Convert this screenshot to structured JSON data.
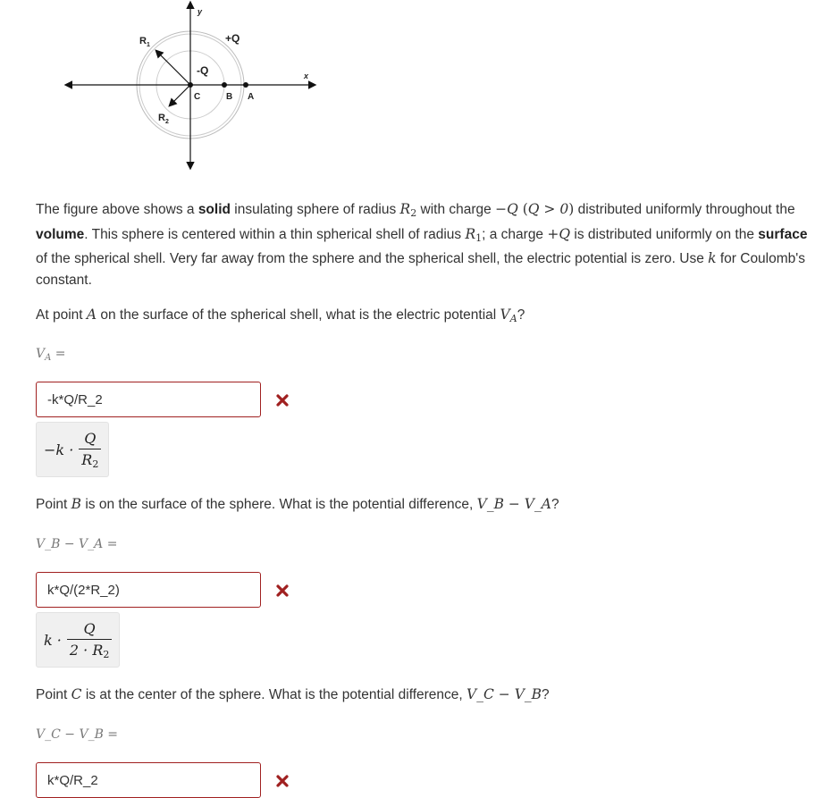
{
  "figure": {
    "labels": {
      "y_axis": "y",
      "x_axis": "x",
      "r1": "R",
      "r1_sub": "1",
      "r2": "R",
      "r2_sub": "2",
      "plus_q": "+Q",
      "minus_q": "-Q",
      "point_c": "C",
      "point_b": "B",
      "point_a": "A"
    }
  },
  "intro": {
    "t1": "The figure above shows a ",
    "b1": "solid",
    "t2": " insulating sphere of radius ",
    "r2_var": "R",
    "r2_sub": "2",
    "t3": " with charge ",
    "charge": "−Q",
    "cond_open": " (",
    "cond": "Q > 0",
    "cond_close": ")",
    "t4": " distributed uniformly throughout the ",
    "b2": "volume",
    "t5": ". This sphere is centered within a thin spherical shell of radius ",
    "r1_var": "R",
    "r1_sub": "1",
    "t6": "; a charge ",
    "pcharge": "+Q",
    "t7": " is distributed uniformly on the ",
    "b3": "surface",
    "t8": " of the spherical shell. Very far away from the sphere and the spherical shell, the electric potential is zero. Use ",
    "kvar": "k",
    "t9": " for Coulomb's constant."
  },
  "questions": [
    {
      "prompt_pre": "At point ",
      "prompt_var": "A",
      "prompt_mid": " on the surface of the spherical shell, what is the electric potential ",
      "prompt_expr_v": "V",
      "prompt_expr_sub": "A",
      "prompt_end": "?",
      "label_v": "V",
      "label_sub": "A",
      "label_rest": " =",
      "answer_value": "-k*Q/R_2",
      "status": "incorrect",
      "preview": {
        "prefix": "−k ·",
        "num": "Q",
        "den": "R",
        "den_sub": "2"
      }
    },
    {
      "prompt_pre": "Point ",
      "prompt_var": "B",
      "prompt_mid": " is on the surface of the sphere. What is the potential difference, ",
      "prompt_expr": "V_B − V_A",
      "prompt_end": "?",
      "label_expr": "V_B − V_A =",
      "answer_value": "k*Q/(2*R_2)",
      "status": "incorrect",
      "preview": {
        "prefix": "k ·",
        "num": "Q",
        "den": "2 · R",
        "den_sub": "2"
      }
    },
    {
      "prompt_pre": "Point ",
      "prompt_var": "C",
      "prompt_mid": " is at the center of the sphere. What is the potential difference, ",
      "prompt_expr": "V_C − V_B",
      "prompt_end": "?",
      "label_expr": "V_C − V_B =",
      "answer_value": "k*Q/R_2",
      "status": "incorrect"
    }
  ],
  "colors": {
    "incorrect": "#a02020",
    "text": "#333333",
    "preview_bg": "#f0f0f0"
  }
}
